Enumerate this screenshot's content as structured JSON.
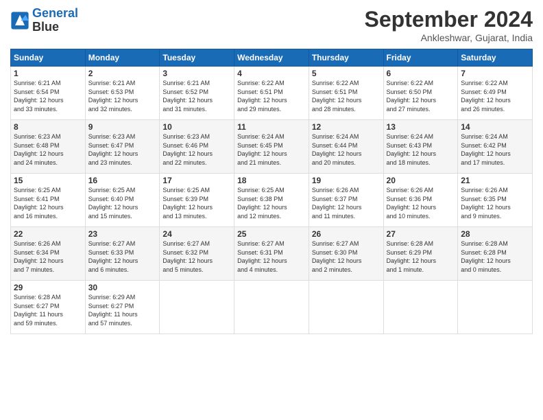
{
  "header": {
    "logo_line1": "General",
    "logo_line2": "Blue",
    "month": "September 2024",
    "location": "Ankleshwar, Gujarat, India"
  },
  "days_of_week": [
    "Sunday",
    "Monday",
    "Tuesday",
    "Wednesday",
    "Thursday",
    "Friday",
    "Saturday"
  ],
  "weeks": [
    [
      {
        "day": "1",
        "info": "Sunrise: 6:21 AM\nSunset: 6:54 PM\nDaylight: 12 hours\nand 33 minutes."
      },
      {
        "day": "2",
        "info": "Sunrise: 6:21 AM\nSunset: 6:53 PM\nDaylight: 12 hours\nand 32 minutes."
      },
      {
        "day": "3",
        "info": "Sunrise: 6:21 AM\nSunset: 6:52 PM\nDaylight: 12 hours\nand 31 minutes."
      },
      {
        "day": "4",
        "info": "Sunrise: 6:22 AM\nSunset: 6:51 PM\nDaylight: 12 hours\nand 29 minutes."
      },
      {
        "day": "5",
        "info": "Sunrise: 6:22 AM\nSunset: 6:51 PM\nDaylight: 12 hours\nand 28 minutes."
      },
      {
        "day": "6",
        "info": "Sunrise: 6:22 AM\nSunset: 6:50 PM\nDaylight: 12 hours\nand 27 minutes."
      },
      {
        "day": "7",
        "info": "Sunrise: 6:22 AM\nSunset: 6:49 PM\nDaylight: 12 hours\nand 26 minutes."
      }
    ],
    [
      {
        "day": "8",
        "info": "Sunrise: 6:23 AM\nSunset: 6:48 PM\nDaylight: 12 hours\nand 24 minutes."
      },
      {
        "day": "9",
        "info": "Sunrise: 6:23 AM\nSunset: 6:47 PM\nDaylight: 12 hours\nand 23 minutes."
      },
      {
        "day": "10",
        "info": "Sunrise: 6:23 AM\nSunset: 6:46 PM\nDaylight: 12 hours\nand 22 minutes."
      },
      {
        "day": "11",
        "info": "Sunrise: 6:24 AM\nSunset: 6:45 PM\nDaylight: 12 hours\nand 21 minutes."
      },
      {
        "day": "12",
        "info": "Sunrise: 6:24 AM\nSunset: 6:44 PM\nDaylight: 12 hours\nand 20 minutes."
      },
      {
        "day": "13",
        "info": "Sunrise: 6:24 AM\nSunset: 6:43 PM\nDaylight: 12 hours\nand 18 minutes."
      },
      {
        "day": "14",
        "info": "Sunrise: 6:24 AM\nSunset: 6:42 PM\nDaylight: 12 hours\nand 17 minutes."
      }
    ],
    [
      {
        "day": "15",
        "info": "Sunrise: 6:25 AM\nSunset: 6:41 PM\nDaylight: 12 hours\nand 16 minutes."
      },
      {
        "day": "16",
        "info": "Sunrise: 6:25 AM\nSunset: 6:40 PM\nDaylight: 12 hours\nand 15 minutes."
      },
      {
        "day": "17",
        "info": "Sunrise: 6:25 AM\nSunset: 6:39 PM\nDaylight: 12 hours\nand 13 minutes."
      },
      {
        "day": "18",
        "info": "Sunrise: 6:25 AM\nSunset: 6:38 PM\nDaylight: 12 hours\nand 12 minutes."
      },
      {
        "day": "19",
        "info": "Sunrise: 6:26 AM\nSunset: 6:37 PM\nDaylight: 12 hours\nand 11 minutes."
      },
      {
        "day": "20",
        "info": "Sunrise: 6:26 AM\nSunset: 6:36 PM\nDaylight: 12 hours\nand 10 minutes."
      },
      {
        "day": "21",
        "info": "Sunrise: 6:26 AM\nSunset: 6:35 PM\nDaylight: 12 hours\nand 9 minutes."
      }
    ],
    [
      {
        "day": "22",
        "info": "Sunrise: 6:26 AM\nSunset: 6:34 PM\nDaylight: 12 hours\nand 7 minutes."
      },
      {
        "day": "23",
        "info": "Sunrise: 6:27 AM\nSunset: 6:33 PM\nDaylight: 12 hours\nand 6 minutes."
      },
      {
        "day": "24",
        "info": "Sunrise: 6:27 AM\nSunset: 6:32 PM\nDaylight: 12 hours\nand 5 minutes."
      },
      {
        "day": "25",
        "info": "Sunrise: 6:27 AM\nSunset: 6:31 PM\nDaylight: 12 hours\nand 4 minutes."
      },
      {
        "day": "26",
        "info": "Sunrise: 6:27 AM\nSunset: 6:30 PM\nDaylight: 12 hours\nand 2 minutes."
      },
      {
        "day": "27",
        "info": "Sunrise: 6:28 AM\nSunset: 6:29 PM\nDaylight: 12 hours\nand 1 minute."
      },
      {
        "day": "28",
        "info": "Sunrise: 6:28 AM\nSunset: 6:28 PM\nDaylight: 12 hours\nand 0 minutes."
      }
    ],
    [
      {
        "day": "29",
        "info": "Sunrise: 6:28 AM\nSunset: 6:27 PM\nDaylight: 11 hours\nand 59 minutes."
      },
      {
        "day": "30",
        "info": "Sunrise: 6:29 AM\nSunset: 6:27 PM\nDaylight: 11 hours\nand 57 minutes."
      },
      null,
      null,
      null,
      null,
      null
    ]
  ]
}
